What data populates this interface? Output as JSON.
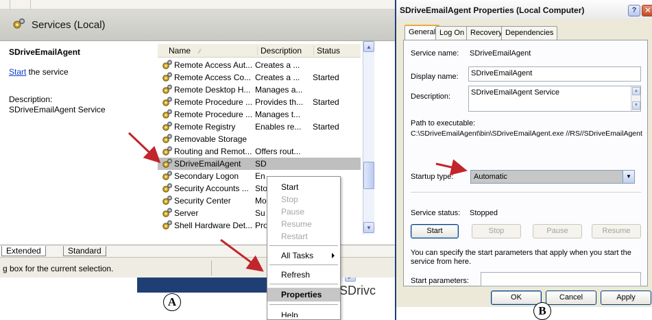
{
  "services_window": {
    "header_title": "Services (Local)",
    "left_pane": {
      "service_name": "SDriveEmailAgent",
      "start_link": "Start",
      "start_suffix": " the service",
      "description_label": "Description:",
      "description_value": "SDriveEmailAgent Service"
    },
    "columns": {
      "name": "Name",
      "description": "Description",
      "status": "Status"
    },
    "rows": [
      {
        "name": "Remote Access Aut...",
        "description": "Creates a ...",
        "status": ""
      },
      {
        "name": "Remote Access Co...",
        "description": "Creates a ...",
        "status": "Started"
      },
      {
        "name": "Remote Desktop H...",
        "description": "Manages a...",
        "status": ""
      },
      {
        "name": "Remote Procedure ...",
        "description": "Provides th...",
        "status": "Started"
      },
      {
        "name": "Remote Procedure ...",
        "description": "Manages t...",
        "status": ""
      },
      {
        "name": "Remote Registry",
        "description": "Enables re...",
        "status": "Started"
      },
      {
        "name": "Removable Storage",
        "description": "",
        "status": ""
      },
      {
        "name": "Routing and Remot...",
        "description": "Offers rout...",
        "status": ""
      },
      {
        "name": "SDriveEmailAgent",
        "description": "SD",
        "status": ""
      },
      {
        "name": "Secondary Logon",
        "description": "En",
        "status": ""
      },
      {
        "name": "Security Accounts ...",
        "description": "Sto",
        "status": ""
      },
      {
        "name": "Security Center",
        "description": "Mo",
        "status": ""
      },
      {
        "name": "Server",
        "description": "Su",
        "status": ""
      },
      {
        "name": "Shell Hardware Det...",
        "description": "Pro",
        "status": ""
      }
    ],
    "tabs": {
      "extended": "Extended",
      "standard": "Standard"
    },
    "status_text": "g box for the current selection.",
    "bottom_text": "SDrivc",
    "label": "A"
  },
  "context_menu": {
    "start": "Start",
    "stop": "Stop",
    "pause": "Pause",
    "resume": "Resume",
    "restart": "Restart",
    "all_tasks": "All Tasks",
    "refresh": "Refresh",
    "properties": "Properties",
    "help": "Help"
  },
  "properties_dialog": {
    "title": "SDriveEmailAgent Properties (Local Computer)",
    "help_glyph": "?",
    "tabs": [
      "General",
      "Log On",
      "Recovery",
      "Dependencies"
    ],
    "service_name_label": "Service name:",
    "service_name_value": "SDriveEmailAgent",
    "display_name_label": "Display name:",
    "display_name_value": "SDriveEmailAgent",
    "description_label": "Description:",
    "description_value": "SDriveEmailAgent Service",
    "path_label": "Path to executable:",
    "path_value": "C:\\SDriveEmailAgent\\bin\\SDriveEmailAgent.exe //RS//SDriveEmailAgent",
    "startup_type_label": "Startup type:",
    "startup_type_value": "Automatic",
    "service_status_label": "Service status:",
    "service_status_value": "Stopped",
    "buttons": {
      "start": "Start",
      "stop": "Stop",
      "pause": "Pause",
      "resume": "Resume"
    },
    "params_note": "You can specify the start parameters that apply when you start the service from here.",
    "start_params_label": "Start parameters:",
    "start_params_value": "",
    "ok": "OK",
    "cancel": "Cancel",
    "apply": "Apply",
    "label": "B"
  },
  "colors": {
    "annotation_arrow": "#c0262c",
    "link": "#0a3cc9",
    "selection": "#bfbfbf"
  }
}
